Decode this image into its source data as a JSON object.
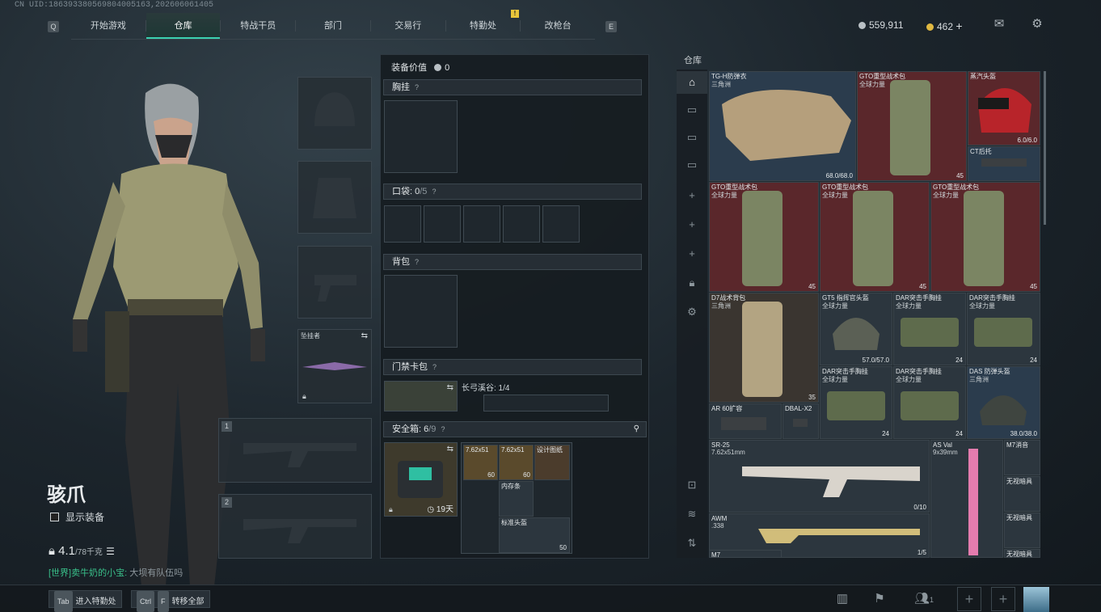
{
  "uid": "CN UID:1863933805698040051​63,2026060614​05",
  "nav": {
    "key_left": "Q",
    "key_right": "E",
    "tabs": [
      "开始游戏",
      "仓库",
      "特战干员",
      "部门",
      "交易行",
      "特勤处",
      "改枪台"
    ],
    "active_tab": "仓库",
    "alert_badge": "!"
  },
  "currency": {
    "silver": "559,911",
    "gold": "462",
    "gold_add": "+",
    "silver_color": "#b9c0c5",
    "gold_color": "#e1b941"
  },
  "icons": {
    "mail": "mail-icon",
    "settings": "gear-icon"
  },
  "character": {
    "name": "骇爪",
    "show_equipment": "显示装备",
    "weight": "4.1",
    "weight_max": "/78千克"
  },
  "chat": {
    "channel": "[世界]",
    "sender": "卖牛奶的小宝",
    "message": "大坝有队伍吗"
  },
  "equip_slots": {
    "pendant_label": "坠挂者",
    "weapon1": "1",
    "weapon2": "2"
  },
  "loadout": {
    "value_label": "装备价值",
    "value": "0",
    "chest_rig": "胸挂",
    "pockets_label": "口袋:",
    "pockets_count": "0",
    "pockets_max": "/5",
    "backpack": "背包",
    "keycard": "门禁卡包",
    "keycard_item": "长弓溪谷: 1/4",
    "safebox_label": "安全箱:",
    "safebox_count": "6",
    "safebox_max": "/9",
    "safebox_timer": "19天",
    "help": "?",
    "safebox_items": [
      {
        "name": "7.62x51",
        "value": "60"
      },
      {
        "name": "7.62x51",
        "value": "60"
      },
      {
        "name": "设计图纸",
        "value": ""
      },
      {
        "name": "内存条",
        "value": ""
      },
      {
        "name": "标准头盔",
        "value": "50"
      }
    ]
  },
  "storage": {
    "title": "仓库",
    "items": [
      {
        "name": "TG-H防弹衣",
        "sub": "三角洲",
        "value": "68.0/68.0",
        "color": "blue"
      },
      {
        "name": "GTO重型战术包",
        "sub": "全球力量",
        "value": "45",
        "color": "red"
      },
      {
        "name": "蒸汽头盔",
        "sub": "",
        "value": "6.0/6.0",
        "color": "red"
      },
      {
        "name": "CT后托",
        "sub": "",
        "value": "",
        "color": "blue"
      },
      {
        "name": "GTO重型战术包",
        "sub": "全球力量",
        "value": "45",
        "color": "red"
      },
      {
        "name": "GTO重型战术包",
        "sub": "全球力量",
        "value": "45",
        "color": "red"
      },
      {
        "name": "GTO重型战术包",
        "sub": "全球力量",
        "value": "45",
        "color": "red"
      },
      {
        "name": "D7战术背包",
        "sub": "三角洲",
        "value": "35",
        "color": "gray"
      },
      {
        "name": "GT5 指挥官头盔",
        "sub": "全球力量",
        "value": "57.0/57.0",
        "color": "gray"
      },
      {
        "name": "DAR突击手胸挂",
        "sub": "全球力量",
        "value": "24",
        "color": "gray"
      },
      {
        "name": "DAR突击手胸挂",
        "sub": "全球力量",
        "value": "24",
        "color": "gray"
      },
      {
        "name": "DAR突击手胸挂",
        "sub": "全球力量",
        "value": "24",
        "color": "gray"
      },
      {
        "name": "DAR突击手胸挂",
        "sub": "全球力量",
        "value": "24",
        "color": "gray"
      },
      {
        "name": "DAS 防弹头盔",
        "sub": "三角洲",
        "value": "38.0/38.0",
        "color": "blue"
      },
      {
        "name": "AR 60扩容",
        "sub": "",
        "value": "",
        "color": "gray"
      },
      {
        "name": "DBAL-X2",
        "sub": "",
        "value": "",
        "color": "gray"
      },
      {
        "name": "SR-25",
        "sub": "7.62x51mm",
        "value": "0/10",
        "color": "gray"
      },
      {
        "name": "AS Val",
        "sub": "9x39mm",
        "value": "",
        "color": "gray"
      },
      {
        "name": "M7消音",
        "sub": "",
        "value": "",
        "color": "gray"
      },
      {
        "name": "无视暗具",
        "sub": "",
        "value": "",
        "color": "gray"
      },
      {
        "name": "AWM",
        "sub": ".338",
        "value": "1/5",
        "color": "gray"
      },
      {
        "name": "无视暗具",
        "sub": "",
        "value": "",
        "color": "gray"
      },
      {
        "name": "M7",
        "sub": "",
        "value": "",
        "color": "gray"
      },
      {
        "name": "无视暗具",
        "sub": "",
        "value": "",
        "color": "gray"
      }
    ]
  },
  "bottom": {
    "tab_key": "Tab",
    "tab_label": "进入特勤处",
    "ctrl_key": "Ctrl",
    "f_key": "F",
    "ctrl_label": "转移全部",
    "squad_count": "1"
  }
}
